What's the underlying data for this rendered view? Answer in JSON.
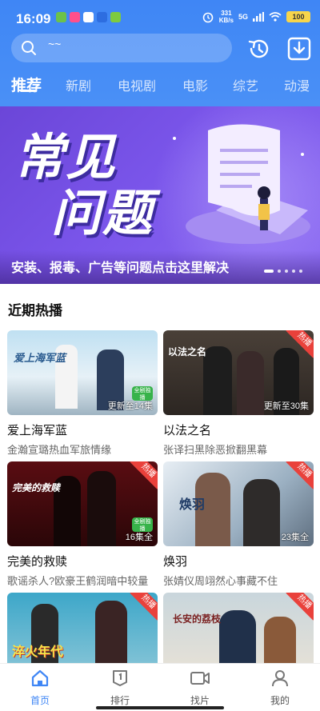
{
  "status": {
    "time": "16:09",
    "speed_value": "331",
    "speed_unit": "KB/s",
    "network": "5G",
    "battery": "100"
  },
  "search": {
    "placeholder": "~~"
  },
  "tabs": [
    "推荐",
    "新剧",
    "电视剧",
    "电影",
    "综艺",
    "动漫"
  ],
  "banner": {
    "title_line1": "常见",
    "title_line2": "问题",
    "subtitle": "安装、报毒、广告等问题点击这里解决"
  },
  "section": {
    "title": "近期热播"
  },
  "cards": [
    {
      "name": "爱上海军蓝",
      "desc": "金瀚宣璐热血军旅情缘",
      "episodes": "更新至14集",
      "caption": "爱上海军蓝",
      "badge": "",
      "full": "全剧独播"
    },
    {
      "name": "以法之名",
      "desc": "张译扫黑除恶掀翻黑幕",
      "episodes": "更新至30集",
      "caption": "以法之名",
      "badge": "热播",
      "full": ""
    },
    {
      "name": "完美的救赎",
      "desc": "歌谣杀人?欧豪王鹤润暗中较量",
      "episodes": "16集全",
      "caption": "完美的救赎",
      "badge": "热播",
      "full": "全剧独播"
    },
    {
      "name": "焕羽",
      "desc": "张婧仪周翊然心事藏不住",
      "episodes": "23集全",
      "caption": "焕羽",
      "badge": "热播",
      "full": ""
    },
    {
      "name": "",
      "desc": "",
      "episodes": "",
      "caption": "淬火年代",
      "badge": "热播",
      "full": ""
    },
    {
      "name": "",
      "desc": "",
      "episodes": "",
      "caption": "长安的荔枝",
      "badge": "热播",
      "full": ""
    }
  ],
  "tabbar": [
    {
      "label": "首页",
      "icon": "home-icon"
    },
    {
      "label": "排行",
      "icon": "ranking-icon"
    },
    {
      "label": "找片",
      "icon": "video-camera-icon"
    },
    {
      "label": "我的",
      "icon": "user-icon"
    }
  ],
  "colors": {
    "primary": "#3f86f5",
    "banner": "#7a55ea",
    "hot_badge": "#e9413b"
  }
}
